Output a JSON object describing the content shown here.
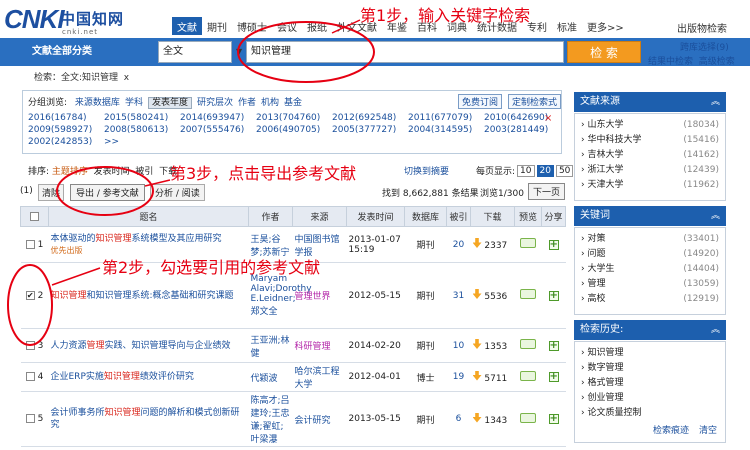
{
  "header": {
    "logo_text": "CNKI",
    "logo_cn": "中国知网",
    "logo_url": "cnki.net",
    "tabs": [
      "文献",
      "期刊",
      "博硕士",
      "会议",
      "报纸",
      "外文文献",
      "年鉴",
      "百科",
      "词典",
      "统计数据",
      "专利",
      "标准",
      "更多>>"
    ],
    "active_tab": "文献",
    "publish_search": "出版物检索"
  },
  "search": {
    "scope": "文献全部分类",
    "field": "全文",
    "keyword": "知识管理",
    "button": "检 索",
    "cross_lang": "跨库选择(9)",
    "in_results": "结果中检索",
    "advanced": "高级检索"
  },
  "crumbs": {
    "label": "检索：",
    "value": "全文:知识管理",
    "close": "x"
  },
  "filter": {
    "label": "分组浏览:",
    "options": [
      "来源数据库",
      "学科",
      "发表年度",
      "研究层次",
      "作者",
      "机构",
      "基金"
    ],
    "active": "发表年度",
    "subscribe": "免费订阅",
    "custom": "定制检索式",
    "years": [
      "2016(16784)",
      "2015(580241)",
      "2014(693947)",
      "2013(704760)",
      "2012(692548)",
      "2011(677079)",
      "2010(642690)",
      "2009(598927)",
      "2008(580613)",
      "2007(555476)",
      "2006(490705)",
      "2005(377727)",
      "2004(314595)",
      "2003(281449)",
      "2002(242853)"
    ],
    "more": ">>",
    "close": "×"
  },
  "sort": {
    "label": "排序:",
    "opts": [
      "主题排序",
      "发表时间",
      "被引",
      "下载"
    ],
    "swap": "切换到摘要",
    "per_page": "每页显示:",
    "sizes": [
      "10",
      "20",
      "50"
    ],
    "size_active": "20"
  },
  "toolbar": {
    "selected": "(1)",
    "clear": "清除",
    "export": "导出 / 参考文献",
    "analyze": "分析 / 阅读",
    "found_prefix": "找到",
    "found_count": "8,662,881",
    "found_suffix": "条结果",
    "browse": "浏览1/300",
    "next": "下一页"
  },
  "table": {
    "headers": [
      "",
      "题名",
      "作者",
      "来源",
      "发表时间",
      "数据库",
      "被引",
      "下载",
      "预览",
      "分享"
    ],
    "rows": [
      {
        "num": "1",
        "checked": false,
        "pre": "本体驱动的",
        "hl": "知识管理",
        "post": "系统模型及其应用研究",
        "sub": "优先出版",
        "author": "王昊;谷梦;苏新宁",
        "source": "中国图书馆学报",
        "date": "2013-01-07 15:19",
        "db": "期刊",
        "cite": "20",
        "dl": "2337"
      },
      {
        "num": "2",
        "checked": true,
        "pre": "",
        "hl": "知识管理",
        "post": "和知识管理系统:概念基础和研究课题",
        "sub": "",
        "author": "Maryam Alavi;Dorothy E.Leidner;郑文全",
        "source": "管理世界",
        "date": "2012-05-15",
        "db": "期刊",
        "cite": "31",
        "dl": "5536"
      },
      {
        "num": "3",
        "checked": false,
        "pre": "人力资源",
        "hl": "管理",
        "post": "实践、知识管理导向与企业绩效",
        "sub": "",
        "author": "王亚洲;林健",
        "source": "科研管理",
        "date": "2014-02-20",
        "db": "期刊",
        "cite": "10",
        "dl": "1353"
      },
      {
        "num": "4",
        "checked": false,
        "pre": "企业ERP实施",
        "hl": "知识管理",
        "post": "绩效评价研究",
        "sub": "",
        "author": "代颖波",
        "source": "哈尔滨工程大学",
        "date": "2012-04-01",
        "db": "博士",
        "cite": "19",
        "dl": "5711"
      },
      {
        "num": "5",
        "checked": false,
        "pre": "会计师事务所",
        "hl": "知识管理",
        "post": "问题的解析和模式创新研究",
        "sub": "",
        "author": "陈高才;吕建玲;王忠谦;翟虹;叶梁瀑",
        "source": "会计研究",
        "date": "2013-05-15",
        "db": "期刊",
        "cite": "6",
        "dl": "1343"
      }
    ]
  },
  "sidebar": {
    "sources_title": "文献来源",
    "sources": [
      {
        "name": "山东大学",
        "count": "(18034)"
      },
      {
        "name": "华中科技大学",
        "count": "(15416)"
      },
      {
        "name": "吉林大学",
        "count": "(14162)"
      },
      {
        "name": "浙江大学",
        "count": "(12439)"
      },
      {
        "name": "天津大学",
        "count": "(11962)"
      }
    ],
    "keywords_title": "关键词",
    "keywords": [
      {
        "name": "对策",
        "count": "(33401)"
      },
      {
        "name": "问题",
        "count": "(14920)"
      },
      {
        "name": "大学生",
        "count": "(14404)"
      },
      {
        "name": "管理",
        "count": "(13059)"
      },
      {
        "name": "高校",
        "count": "(12919)"
      }
    ],
    "history_title": "检索历史:",
    "history": [
      "知识管理",
      "数字管理",
      "格式管理",
      "创业管理",
      "论文质量控制"
    ],
    "clear_trace": "检索痕迹",
    "clear": "清空"
  },
  "annotations": {
    "step1": "第1步，输入关键字检索",
    "step2": "第2步，勾选要引用的参考文献",
    "step3": "第3步，点击导出参考文献",
    "color": "#e60012"
  }
}
